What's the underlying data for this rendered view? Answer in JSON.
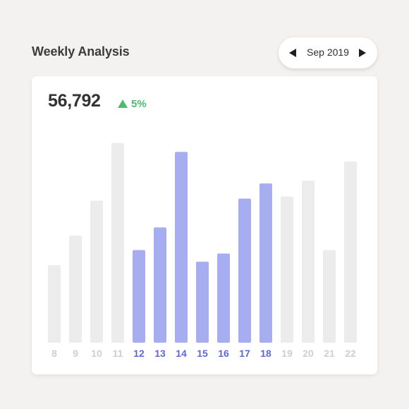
{
  "header": {
    "title": "Weekly Analysis"
  },
  "month_picker": {
    "prev_icon": "triangle-left-icon",
    "label": "Sep 2019",
    "next_icon": "triangle-right-icon"
  },
  "summary": {
    "total": "56,792",
    "change": "5%",
    "change_icon": "triangle-up-icon",
    "change_color": "#4cbd6e"
  },
  "colors": {
    "highlight_bar": "#a7aef0",
    "highlight_label": "#6068d6",
    "dim_bar": "#ececec",
    "dim_label": "#cfcfcf",
    "background": "#f3f2f0",
    "card": "#ffffff"
  },
  "chart_data": {
    "type": "bar",
    "categories": [
      "8",
      "9",
      "10",
      "11",
      "12",
      "13",
      "14",
      "15",
      "16",
      "17",
      "18",
      "19",
      "20",
      "21",
      "22"
    ],
    "values": [
      113,
      156,
      207,
      291,
      135,
      168,
      278,
      118,
      130,
      210,
      232,
      213,
      236,
      135,
      264
    ],
    "highlighted": [
      false,
      false,
      false,
      false,
      true,
      true,
      true,
      true,
      true,
      true,
      true,
      false,
      false,
      false,
      false
    ],
    "ylim": [
      0,
      300
    ],
    "grid": false,
    "title": "",
    "xlabel": "",
    "ylabel": ""
  }
}
